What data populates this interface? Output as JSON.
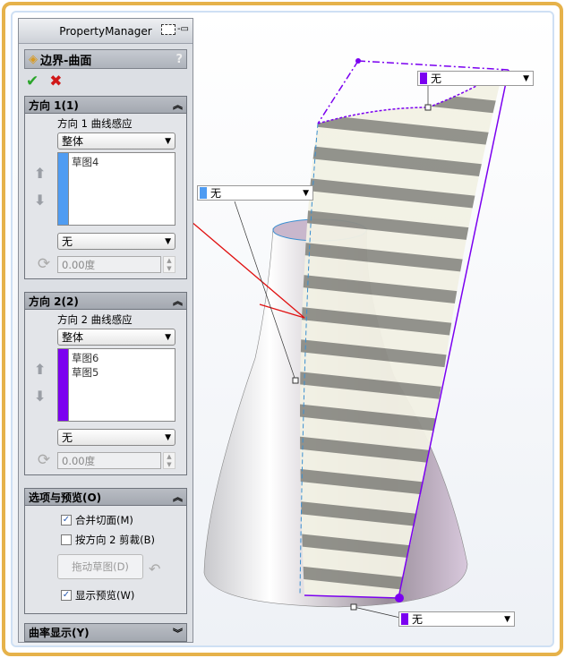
{
  "panel": {
    "title": "PropertyManager",
    "feature_title": "边界-曲面",
    "help": "?",
    "ok": "✔",
    "cancel": "✖"
  },
  "direction1": {
    "header": "方向 1(1)",
    "curve_label": "方向 1 曲线感应",
    "influence": "整体",
    "items": [
      "草图4"
    ],
    "tangent": "无",
    "angle": "0.00度",
    "color": "#4f9cf2"
  },
  "direction2": {
    "header": "方向 2(2)",
    "curve_label": "方向 2 曲线感应",
    "influence": "整体",
    "items": [
      "草图6",
      "草图5"
    ],
    "tangent": "无",
    "angle": "0.00度",
    "color": "#7b00f0"
  },
  "options": {
    "header": "选项与预览(O)",
    "merge": "合并切面(M)",
    "merge_checked": true,
    "trim": "按方向 2 剪裁(B)",
    "trim_checked": false,
    "drag_button": "拖动草图(D)",
    "preview": "显示预览(W)",
    "preview_checked": true
  },
  "curvature": {
    "header": "曲率显示(Y)"
  },
  "callouts": {
    "top": "无",
    "left": "无",
    "bottom": "无"
  },
  "arrows": {
    "up": "⬆",
    "down": "⬇",
    "rotate": "⟳",
    "dropdown": "▼",
    "collapse": "≈",
    "check": "✓"
  }
}
